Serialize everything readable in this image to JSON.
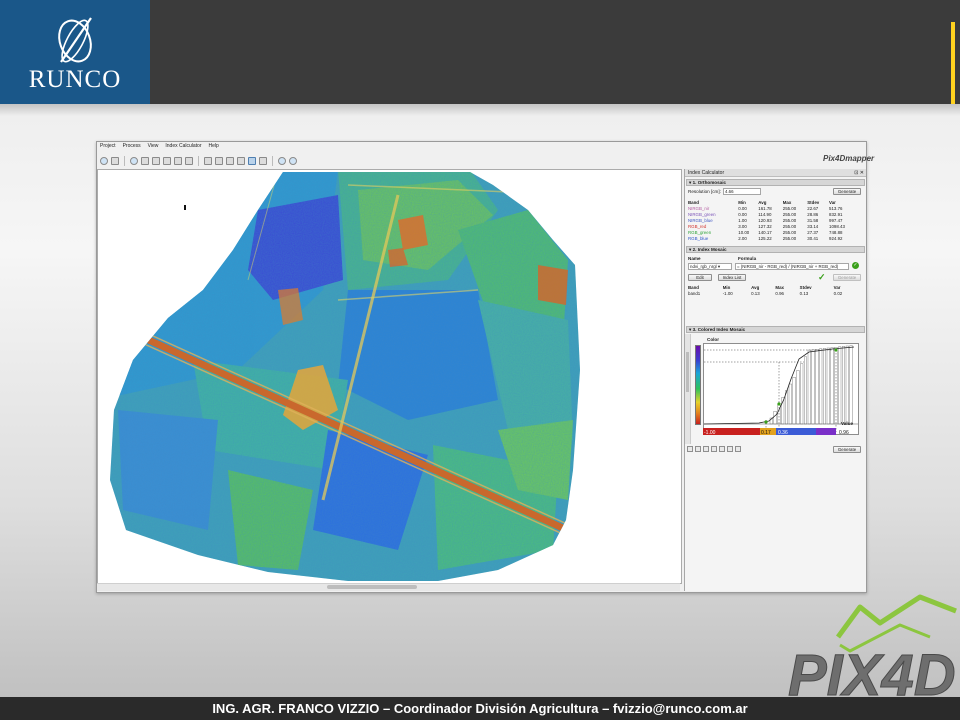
{
  "slide": {
    "logo_text": "RUNCO",
    "footer": "ING. AGR. FRANCO VIZZIO – Coordinador División Agricultura – fvizzio@runco.com.ar",
    "pix4d_logo_text": "PIX4D",
    "colors": {
      "header": "#3b3b3b",
      "logo_bg": "#1a5789",
      "accent": "#ffd21f",
      "pix4d_green": "#8cc63f"
    }
  },
  "app": {
    "menu": [
      "Project",
      "Process",
      "View",
      "Index Calculator",
      "Help"
    ],
    "brand": "Pix4Dmapper",
    "panel": {
      "title": "Index Calculator",
      "section1": "1. Orthomosaic",
      "resolution_label": "Resolution [cm]:",
      "resolution_value": "4.66",
      "generate_label": "Generate",
      "band_headers": [
        "Band",
        "Min",
        "Avg",
        "Max",
        "Stdev",
        "Var"
      ],
      "bands": [
        {
          "name": "NIRGB_nir",
          "min": "0.00",
          "avg": "161.78",
          "max": "255.00",
          "stdev": "22.67",
          "var": "513.76",
          "color": "#b35aa0"
        },
        {
          "name": "NIRGB_green",
          "min": "0.00",
          "avg": "114.90",
          "max": "255.00",
          "stdev": "28.86",
          "var": "832.91",
          "color": "#7a52b8"
        },
        {
          "name": "NIRGB_blue",
          "min": "1.00",
          "avg": "120.93",
          "max": "255.00",
          "stdev": "31.58",
          "var": "997.47",
          "color": "#3d56c4"
        },
        {
          "name": "RGB_red",
          "min": "3.00",
          "avg": "127.32",
          "max": "255.00",
          "stdev": "33.14",
          "var": "1098.43",
          "color": "#d0312d"
        },
        {
          "name": "RGB_green",
          "min": "10.00",
          "avg": "140.17",
          "max": "255.00",
          "stdev": "27.37",
          "var": "748.88",
          "color": "#2fa33a"
        },
        {
          "name": "RGB_blue",
          "min": "2.00",
          "avg": "125.22",
          "max": "255.00",
          "stdev": "30.41",
          "var": "924.92",
          "color": "#2f55c8"
        }
      ],
      "section2": "2. Index Mosaic",
      "name_header": "Name",
      "formula_header": "Formula",
      "index_name": "ndvi_rgb_nrgl",
      "formula": "= (NIRGB_nir - RGB_red) / (NIRGB_nir + RGB_red)",
      "edit_label": "Edit",
      "index_list_label": "Index List",
      "index_band_headers": [
        "Band",
        "Min",
        "Avg",
        "Max",
        "Stdev",
        "Var"
      ],
      "index_band": {
        "name": "band1",
        "min": "-1.00",
        "avg": "0.13",
        "max": "0.96",
        "stdev": "0.13",
        "var": "0.02"
      },
      "section3": "3. Colored Index Mosaic",
      "color_label": "Color",
      "value_label": "Value",
      "value_ticks": [
        "-1.00",
        "0.17",
        "0.36",
        "0.96"
      ]
    }
  }
}
